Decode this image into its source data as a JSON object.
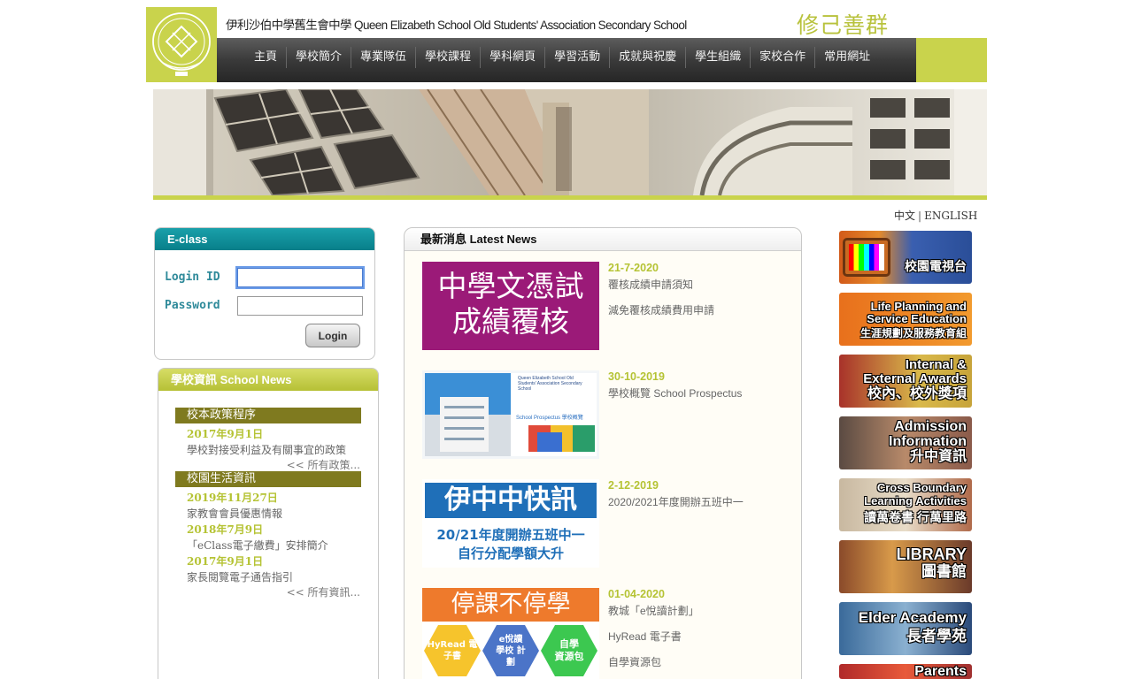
{
  "header": {
    "school_title": "伊利沙伯中學舊生會中學 Queen Elizabeth School Old Students' Association Secondary School",
    "motto": "修己善群",
    "logo_icon": "school-crest-icon",
    "nav": [
      "主頁",
      "學校簡介",
      "專業隊伍",
      "學校課程",
      "學科網頁",
      "學習活動",
      "成就與祝慶",
      "學生組織",
      "家校合作",
      "常用網址"
    ]
  },
  "colors": {
    "lime": "#c9d34c",
    "teal": "#0b8b96",
    "olive": "#7f7a1f",
    "date_green": "#b5c334"
  },
  "lang": {
    "zh": "中文",
    "sep": "|",
    "en": "ENGLISH"
  },
  "eclass": {
    "title": "E-class",
    "login_id_label": "Login ID",
    "password_label": "Password",
    "login_id_value": "",
    "password_value": "",
    "login_button": "Login"
  },
  "school_news": {
    "title": "學校資訊 School News",
    "categories": [
      {
        "name": "校本政策程序",
        "items": [
          {
            "date": "2017年9月1日",
            "text": "學校對接受利益及有關事宜的政策"
          }
        ],
        "more": "<< 所有政策..."
      },
      {
        "name": "校園生活資訊",
        "items": [
          {
            "date": "2019年11月27日",
            "text": "家教會會員優惠情報"
          },
          {
            "date": "2018年7月9日",
            "text": "「eClass電子繳費」安排簡介"
          },
          {
            "date": "2017年9月1日",
            "text": "家長閱覽電子通告指引"
          }
        ],
        "more": "<< 所有資訊..."
      }
    ]
  },
  "latest_news": {
    "title": "最新消息 Latest News",
    "items": [
      {
        "date": "21-7-2020",
        "lines": [
          "覆核成績申請須知",
          "減免覆核成績費用申請"
        ],
        "thumb_text": [
          "中學文憑試",
          "成績覆核"
        ]
      },
      {
        "date": "30-10-2019",
        "lines": [
          "學校概覽 School Prospectus"
        ],
        "thumb_text": [
          "Queen Elizabeth School Old Students' Association Secondary School",
          "School Prospectus 學校概覽"
        ]
      },
      {
        "date": "2-12-2019",
        "lines": [
          "2020/2021年度開辦五班中一"
        ],
        "thumb_text": [
          "伊中中快訊",
          "20/21年度開辦五班中一",
          "自行分配學額大升"
        ]
      },
      {
        "date": "01-04-2020",
        "lines": [
          "教城「e悅讀計劃」",
          "HyRead 電子書",
          "自學資源包"
        ],
        "thumb_text": [
          "停課不停學",
          "HyRead 電子書",
          "e悅讀 學校 計劃",
          "自學 資源包"
        ]
      }
    ]
  },
  "tiles": [
    {
      "lines": [
        "校園電視台"
      ],
      "icon": "tv-icon"
    },
    {
      "lines": [
        "Life Planning and",
        "Service Education",
        "生涯規劃及服務教育組"
      ]
    },
    {
      "lines": [
        "Internal &",
        "External Awards",
        "校內、校外獎項"
      ]
    },
    {
      "lines": [
        "Admission",
        "Information",
        "升中資訊"
      ]
    },
    {
      "lines": [
        "Cross Boundary",
        "Learning Activities",
        "讀萬卷書 行萬里路"
      ]
    },
    {
      "lines": [
        "LIBRARY",
        "圖書館"
      ]
    },
    {
      "lines": [
        "Elder Academy",
        "長者學苑"
      ]
    },
    {
      "lines": [
        "Parents"
      ]
    }
  ]
}
